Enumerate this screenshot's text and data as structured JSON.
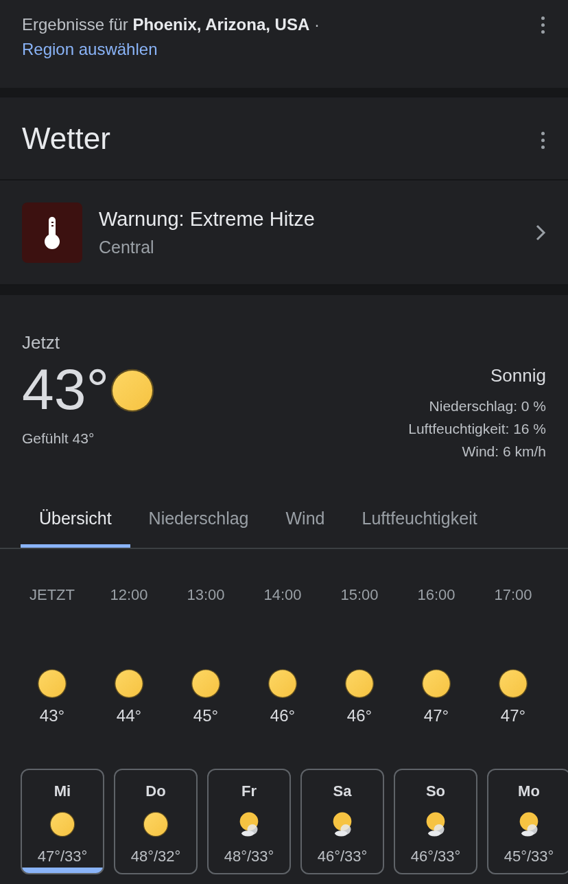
{
  "results": {
    "text": "Ergebnisse für **Phoenix, Arizona, USA** ·",
    "link": "Region auswählen"
  },
  "weather": {
    "title": "Wetter"
  },
  "warning": {
    "title": "Warnung: Extreme Hitze",
    "region": "Central"
  },
  "current": {
    "label": "Jetzt",
    "temp": "43°",
    "kind": "sunny",
    "feels": "Gefühlt 43°",
    "condition": "Sonnig",
    "details": [
      "Niederschlag: 0 %",
      "Luftfeuchtigkeit: 16 %",
      "Wind: 6 km/h"
    ]
  },
  "tabs": [
    {
      "label": "Übersicht",
      "selected": true
    },
    {
      "label": "Niederschlag",
      "selected": false
    },
    {
      "label": "Wind",
      "selected": false
    },
    {
      "label": "Luftfeuchtigkeit",
      "selected": false
    }
  ],
  "hours": [
    {
      "time": "JETZT",
      "kind": "sunny",
      "temp": "43°"
    },
    {
      "time": "12:00",
      "kind": "sunny",
      "temp": "44°"
    },
    {
      "time": "13:00",
      "kind": "sunny",
      "temp": "45°"
    },
    {
      "time": "14:00",
      "kind": "sunny",
      "temp": "46°"
    },
    {
      "time": "15:00",
      "kind": "sunny",
      "temp": "46°"
    },
    {
      "time": "16:00",
      "kind": "sunny",
      "temp": "47°"
    },
    {
      "time": "17:00",
      "kind": "sunny",
      "temp": "47°"
    }
  ],
  "days": [
    {
      "day": "Mi",
      "kind": "sunny",
      "temps": "47°/33°",
      "selected": true
    },
    {
      "day": "Do",
      "kind": "sunny",
      "temps": "48°/32°",
      "selected": false
    },
    {
      "day": "Fr",
      "kind": "partly-cloudy",
      "temps": "48°/33°",
      "selected": false
    },
    {
      "day": "Sa",
      "kind": "partly-cloudy",
      "temps": "46°/33°",
      "selected": false
    },
    {
      "day": "So",
      "kind": "partly-cloudy",
      "temps": "46°/33°",
      "selected": false
    },
    {
      "day": "Mo",
      "kind": "partly-cloudy",
      "temps": "45°/33°",
      "selected": false
    }
  ]
}
